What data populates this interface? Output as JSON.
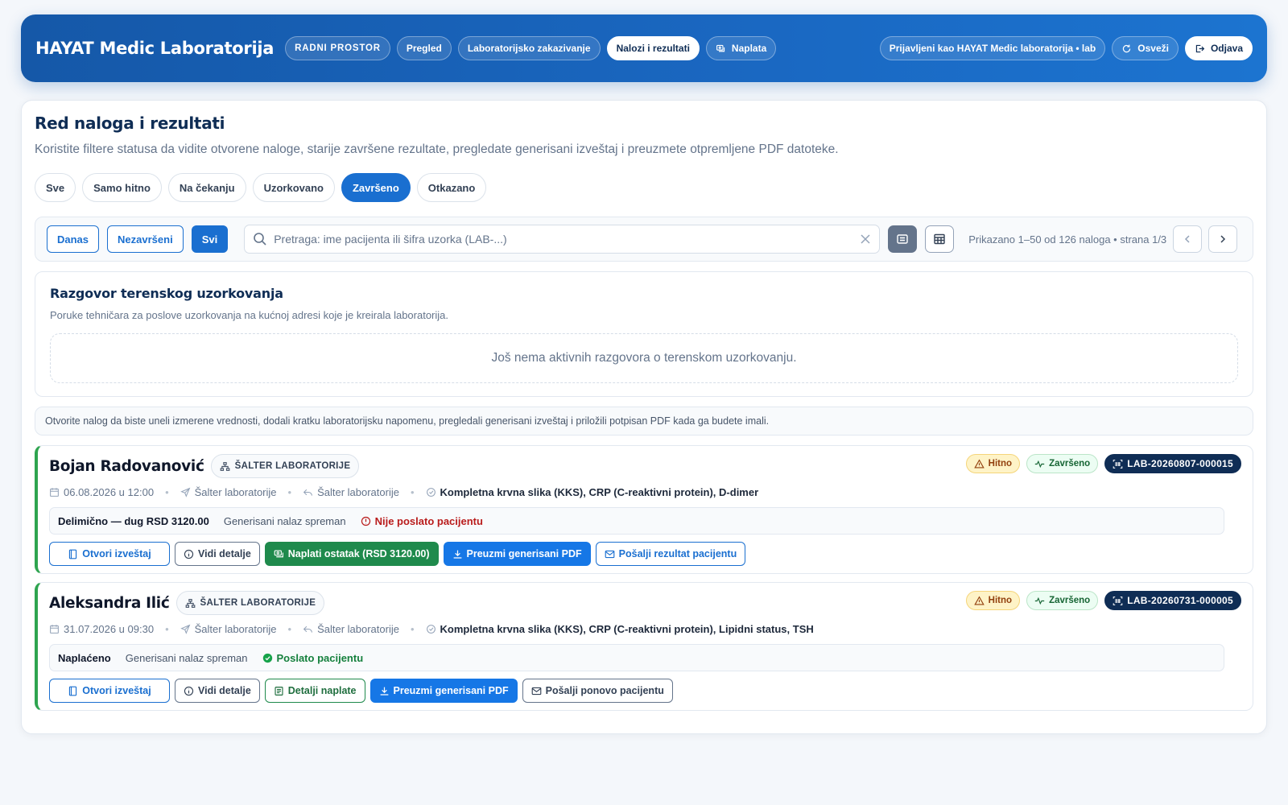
{
  "header": {
    "brand": "HAYAT Medic Laboratorija",
    "nav": [
      {
        "label": "RADNI PROSTOR"
      },
      {
        "label": "Pregled"
      },
      {
        "label": "Laboratorijsko zakazivanje"
      },
      {
        "label": "Nalozi i rezultati"
      },
      {
        "label": "Naplata"
      }
    ],
    "user": "Prijavljeni kao HAYAT Medic laboratorija • lab",
    "refresh": "Osveži",
    "logout": "Odjava"
  },
  "page": {
    "title": "Red naloga i rezultati",
    "subtitle": "Koristite filtere statusa da vidite otvorene naloge, starije završene rezultate, pregledate generisani izveštaj i preuzmete otpremljene PDF datoteke.",
    "status_filters": [
      "Sve",
      "Samo hitno",
      "Na čekanju",
      "Uzorkovano",
      "Završeno",
      "Otkazano"
    ],
    "active_status": "Završeno"
  },
  "toolbar": {
    "range": [
      "Danas",
      "Nezavršeni",
      "Svi"
    ],
    "active_range": "Svi",
    "search_placeholder": "Pretraga: ime pacijenta ili šifra uzorka (LAB-...)",
    "search_value": "",
    "pager": "Prikazano 1–50 od 126 naloga • strana 1/3"
  },
  "conversation": {
    "title": "Razgovor terenskog uzorkovanja",
    "subtitle": "Poruke tehničara za poslove uzorkovanja na kućnoj adresi koje je kreirala laboratorija.",
    "empty": "Još nema aktivnih razgovora o terenskom uzorkovanju."
  },
  "hint": "Otvorite nalog da biste uneli izmerene vrednosti, dodali kratku laboratorijsku napomenu, pregledali generisani izveštaj i priložili potpisan PDF kada ga budete imali.",
  "orders": [
    {
      "patient": "Bojan Radovanović",
      "location": "ŠALTER LABORATORIJE",
      "urgent": "Hitno",
      "status": "Završeno",
      "code": "LAB-20260807-000015",
      "datetime": "06.08.2026 u 12:00",
      "sent_from": "Šalter laboratorije",
      "return_to": "Šalter laboratorije",
      "tests": "Kompletna krvna slika (KKS), CRP (C-reaktivni protein), D-dimer",
      "payment": "Delimično — dug RSD 3120.00",
      "generated": "Generisani nalaz spreman",
      "sent_status": "Nije poslato pacijentu",
      "actions": [
        "Otvori izveštaj",
        "Vidi detalje",
        "Naplati ostatak (RSD 3120.00)",
        "Preuzmi generisani PDF",
        "Pošalji rezultat pacijentu"
      ]
    },
    {
      "patient": "Aleksandra Ilić",
      "location": "ŠALTER LABORATORIJE",
      "urgent": "Hitno",
      "status": "Završeno",
      "code": "LAB-20260731-000005",
      "datetime": "31.07.2026 u 09:30",
      "sent_from": "Šalter laboratorije",
      "return_to": "Šalter laboratorije",
      "tests": "Kompletna krvna slika (KKS), CRP (C-reaktivni protein), Lipidni status, TSH",
      "payment": "Naplaćeno",
      "generated": "Generisani nalaz spreman",
      "sent_status": "Poslato pacijentu",
      "actions": [
        "Otvori izveštaj",
        "Vidi detalje",
        "Detalji naplate",
        "Preuzmi generisani PDF",
        "Pošalji ponovo pacijentu"
      ]
    }
  ],
  "colors": {
    "header": "#1a68c2",
    "accent": "#1a6fd0",
    "success": "#1f8a4c",
    "danger": "#b91c1c",
    "navy": "#0f2d55"
  }
}
